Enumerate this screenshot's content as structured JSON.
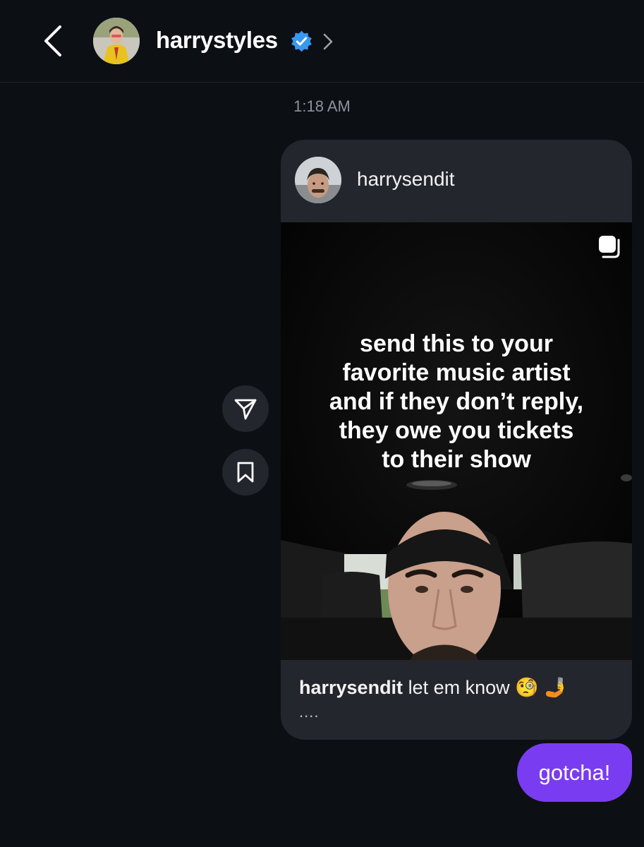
{
  "header": {
    "username": "harrystyles",
    "verified": true,
    "icons": {
      "back": "chevron-left-icon",
      "badge": "verified-badge-icon",
      "profile_link": "chevron-right-icon"
    }
  },
  "conversation": {
    "timestamp": "1:18 AM",
    "shared_post": {
      "username": "harrysendit",
      "overlay_text": "send this to your\nfavorite music artist\nand if they don’t reply,\nthey owe you tickets\nto their show",
      "caption_user": "harrysendit",
      "caption_text": "let em know 🧐 🤳",
      "caption_more": "....",
      "multi_media_icon": "carousel-icon"
    },
    "side_actions": {
      "share_icon": "paper-plane-icon",
      "save_icon": "bookmark-icon"
    },
    "reply": {
      "text": "gotcha!"
    }
  },
  "colors": {
    "background": "#0c0f14",
    "card": "#23262d",
    "reply_bubble": "#7a3cf0",
    "verified": "#3897f0",
    "timestamp": "#8d939c"
  }
}
